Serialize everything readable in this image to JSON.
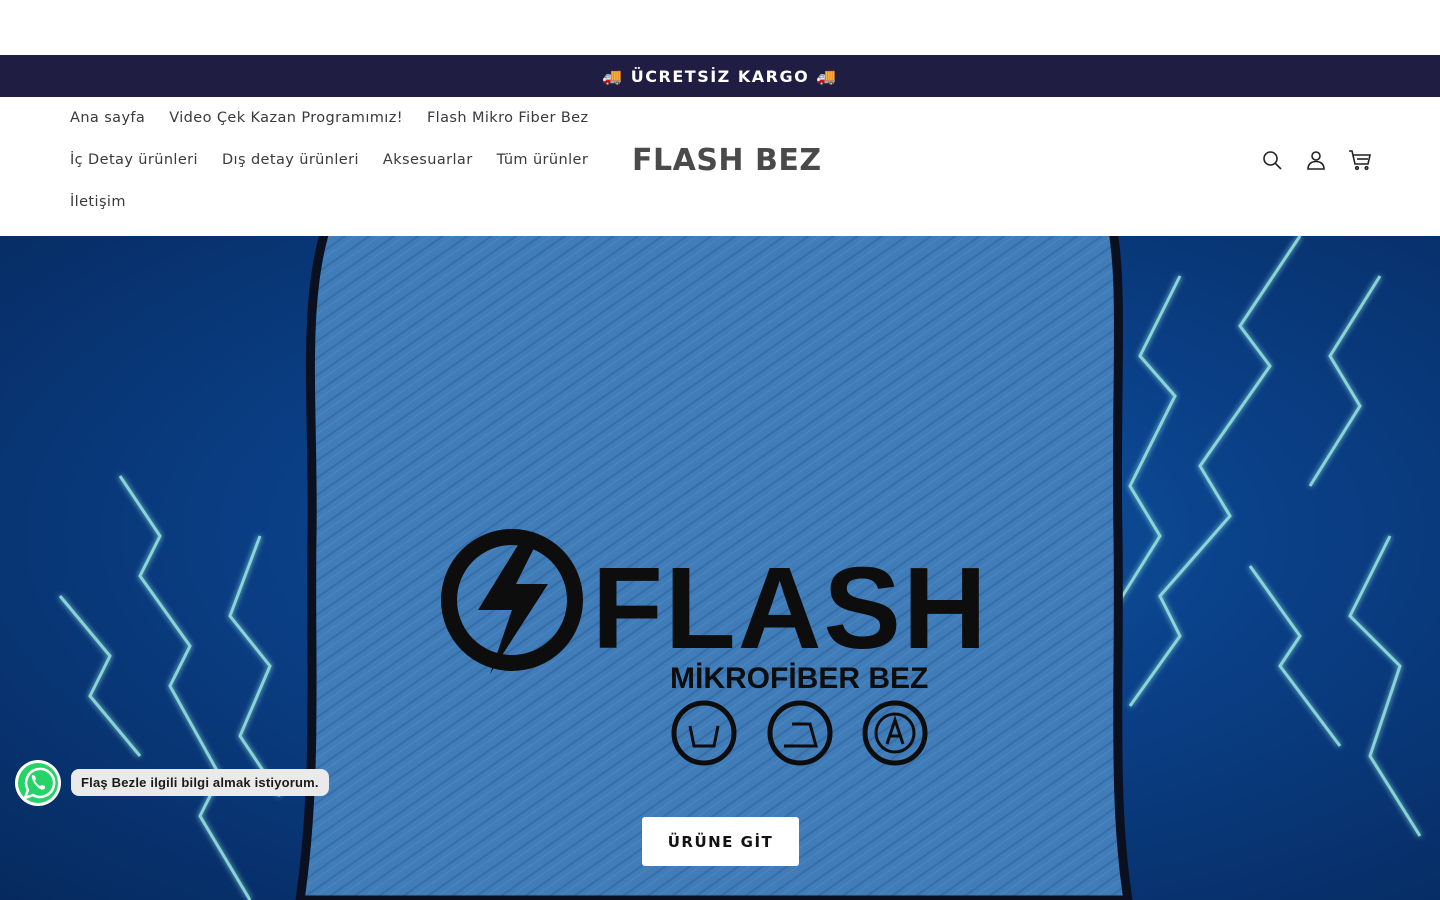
{
  "announcement": {
    "text": "🚚 ÜCRETSİZ KARGO 🚚"
  },
  "nav": {
    "items": [
      {
        "label": "Ana sayfa"
      },
      {
        "label": "Video Çek Kazan Programımız!"
      },
      {
        "label": "Flash Mikro Fiber Bez"
      },
      {
        "label": "İç Detay ürünleri"
      },
      {
        "label": "Dış detay ürünleri"
      },
      {
        "label": "Aksesuarlar"
      },
      {
        "label": "Tüm ürünler"
      },
      {
        "label": "İletişim"
      }
    ]
  },
  "header": {
    "logo": "FLASH BEZ",
    "icons": [
      "search-icon",
      "account-icon",
      "cart-icon"
    ]
  },
  "hero": {
    "brand_text": "FLASH",
    "sub_text": "MİKROFİBER BEZ",
    "cta_label": "ÜRÜNE GİT"
  },
  "whatsapp": {
    "message": "Flaş Bezle ilgili bilgi almak istiyorum."
  },
  "colors": {
    "announcement_bg": "#1f1d42",
    "hero_bg": "#0a3f86",
    "cloth": "#3f7cb8",
    "lightning": "#9ff0e6",
    "whatsapp_green": "#25d366"
  }
}
